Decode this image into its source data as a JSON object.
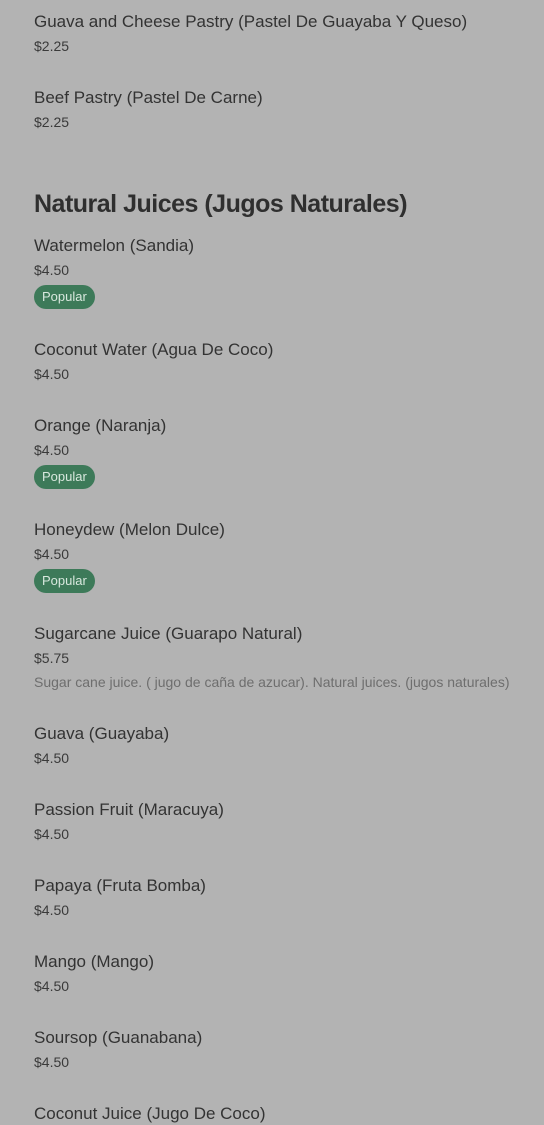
{
  "sections": [
    {
      "title": "",
      "items": [
        {
          "name": "Guava and Cheese Pastry (Pastel De Guayaba Y Queso)",
          "price": "$2.25"
        },
        {
          "name": "Beef Pastry (Pastel De Carne)",
          "price": "$2.25"
        }
      ]
    },
    {
      "title": "Natural Juices (Jugos Naturales)",
      "items": [
        {
          "name": "Watermelon (Sandia)",
          "price": "$4.50",
          "badge": "Popular"
        },
        {
          "name": "Coconut Water (Agua De Coco)",
          "price": "$4.50"
        },
        {
          "name": "Orange (Naranja)",
          "price": "$4.50",
          "badge": "Popular"
        },
        {
          "name": "Honeydew (Melon Dulce)",
          "price": "$4.50",
          "badge": "Popular"
        },
        {
          "name": "Sugarcane Juice (Guarapo Natural)",
          "price": "$5.75",
          "description": "Sugar cane juice. ( jugo de caña de azucar). Natural juices. (jugos naturales)"
        },
        {
          "name": "Guava (Guayaba)",
          "price": "$4.50"
        },
        {
          "name": "Passion Fruit (Maracuya)",
          "price": "$4.50"
        },
        {
          "name": "Papaya (Fruta Bomba)",
          "price": "$4.50"
        },
        {
          "name": "Mango (Mango)",
          "price": "$4.50"
        },
        {
          "name": "Soursop (Guanabana)",
          "price": "$4.50"
        },
        {
          "name": "Coconut Juice (Jugo De Coco)",
          "price": ""
        }
      ]
    }
  ],
  "colors": {
    "background": "#b3b3b3",
    "badge_bg": "#3d7a59",
    "badge_text": "#d8e8de"
  }
}
